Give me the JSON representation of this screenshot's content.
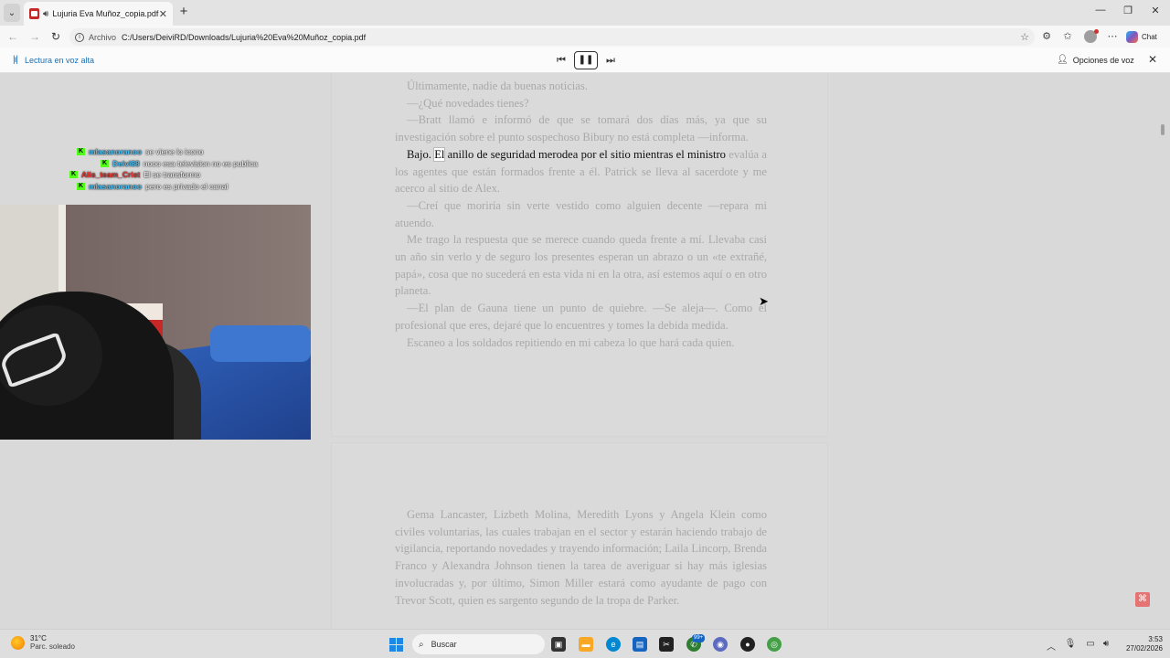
{
  "browser": {
    "tab_title": "Lujuria Eva Muñoz_copia.pdf",
    "url_scheme_label": "Archivo",
    "url": "C:/Users/DeiviRD/Downloads/Lujuria%20Eva%20Muñoz_copia.pdf",
    "chat_label": "Chat"
  },
  "read_aloud": {
    "label": "Lectura en voz alta",
    "voice_options": "Opciones de voz"
  },
  "pdf": {
    "page1": {
      "paragraphs": [
        "Últimamente, nadie da buenas noticias.",
        "—¿Qué novedades tienes?",
        "—Bratt llamó e informó de que se tomará dos días más, ya que su investigación sobre el punto sospechoso Bibury no está completa —informa."
      ],
      "highlight_before": "Bajo. ",
      "highlight_word": "El",
      "highlight_after": " anillo de seguridad merodea por el sitio mientras el ministro",
      "para4_rest": "evalúa a los agentes que están formados frente a él. Patrick se lleva al sacerdote y me acerco al sitio de Alex.",
      "paragraphs_after": [
        "—Creí que moriría sin verte vestido como alguien decente —repara mi atuendo.",
        "Me trago la respuesta que se merece cuando queda frente a mí. Llevaba casi un año sin verlo y de seguro los presentes esperan un abrazo o un «te extrañé, papá», cosa que no sucederá en esta vida ni en la otra, así estemos aquí o en otro planeta.",
        "—El plan de Gauna tiene un punto de quiebre. —Se aleja—. Como el profesional que eres, dejaré que lo encuentres y tomes la debida medida.",
        "Escaneo a los soldados repitiendo en mi cabeza lo que hará cada quien."
      ]
    },
    "page2": {
      "paragraphs": [
        "Gema Lancaster, Lizbeth Molina, Meredith Lyons y Angela Klein como civiles voluntarias, las cuales trabajan en el sector y estarán haciendo trabajo de vigilancia, reportando novedades y trayendo información; Laila Lincorp, Brenda Franco y Alexandra Johnson tienen la tarea de averiguar si hay más iglesias involucradas y, por último, Simon Miller estará como ayudante de pago con Trevor Scott, quien es sargento segundo de la tropa de Parker."
      ]
    }
  },
  "stream_chat": [
    {
      "user": "mlasanoranoo",
      "message": "se viene lo icono",
      "color": "#4fc3f7"
    },
    {
      "user": "Deivi88",
      "message": "nooo esa television no es publica",
      "color": "#4fc3f7"
    },
    {
      "user": "Alis_team_Crist",
      "message": "El se transformo",
      "color": "#e53935"
    },
    {
      "user": "mlasanoranoo",
      "message": "pero es privado el canal",
      "color": "#4fc3f7"
    }
  ],
  "taskbar": {
    "weather_temp": "31°C",
    "weather_desc": "Parc. soleado",
    "search_placeholder": "Buscar",
    "whatsapp_badge": "99+",
    "time": "3:53",
    "date": "27/02/2026"
  },
  "colors": {
    "accent": "#1a6fb3",
    "kick_green": "#53fc18",
    "pdf_red": "#c62828"
  }
}
